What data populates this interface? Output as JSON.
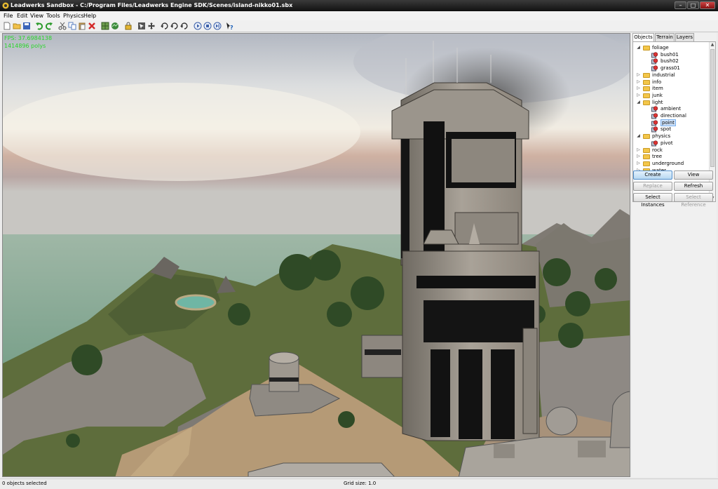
{
  "window": {
    "title": "Leadwerks Sandbox - C:/Program Files/Leadwerks Engine SDK/Scenes/island-nikko01.sbx",
    "controls": [
      "–",
      "□",
      "✕"
    ]
  },
  "menu": [
    "File",
    "Edit",
    "View",
    "Tools",
    "Physics",
    "Help"
  ],
  "toolbar": [
    "new-icon",
    "open-icon",
    "save-icon",
    "undo-icon",
    "redo-icon",
    "cut-icon",
    "copy-icon",
    "paste-icon",
    "delete-icon",
    "grid-icon",
    "terrain-icon",
    "lock-icon",
    "select-icon",
    "move-icon",
    "rotate-x-icon",
    "rotate-y-icon",
    "rotate-z-icon",
    "play-icon",
    "pause-icon",
    "step-icon",
    "help-icon"
  ],
  "viewport": {
    "fps": "FPS: 37.6984138",
    "polys": "1414896 polys"
  },
  "panel": {
    "tabs": [
      "Objects",
      "Terrain",
      "Layers"
    ],
    "active_tab": "Objects",
    "tree": [
      {
        "label": "foliage",
        "kind": "folder",
        "level": 0,
        "expanded": true
      },
      {
        "label": "bush01",
        "kind": "entity",
        "level": 1
      },
      {
        "label": "bush02",
        "kind": "entity",
        "level": 1
      },
      {
        "label": "grass01",
        "kind": "entity",
        "level": 1
      },
      {
        "label": "industrial",
        "kind": "folder",
        "level": 0,
        "expanded": false
      },
      {
        "label": "info",
        "kind": "folder",
        "level": 0,
        "expanded": false
      },
      {
        "label": "item",
        "kind": "folder",
        "level": 0,
        "expanded": false
      },
      {
        "label": "junk",
        "kind": "folder",
        "level": 0,
        "expanded": false
      },
      {
        "label": "light",
        "kind": "folder",
        "level": 0,
        "expanded": true
      },
      {
        "label": "ambient",
        "kind": "entity",
        "level": 1
      },
      {
        "label": "directional",
        "kind": "entity",
        "level": 1
      },
      {
        "label": "point",
        "kind": "entity",
        "level": 1,
        "selected": true
      },
      {
        "label": "spot",
        "kind": "entity",
        "level": 1
      },
      {
        "label": "physics",
        "kind": "folder",
        "level": 0,
        "expanded": true
      },
      {
        "label": "pivot",
        "kind": "entity",
        "level": 1
      },
      {
        "label": "rock",
        "kind": "folder",
        "level": 0,
        "expanded": false
      },
      {
        "label": "tree",
        "kind": "folder",
        "level": 0,
        "expanded": false
      },
      {
        "label": "underground",
        "kind": "folder",
        "level": 0,
        "expanded": false
      },
      {
        "label": "water",
        "kind": "folder",
        "level": 0,
        "expanded": false
      }
    ],
    "buttons": {
      "create": "Create",
      "view": "View",
      "replace": "Replace",
      "refresh": "Refresh",
      "select_instances": "Select Instances",
      "select_reference": "Select Reference"
    }
  },
  "status": {
    "selection": "0 objects selected",
    "grid": "Grid size: 1.0"
  },
  "colors": {
    "fps_text": "#2bd62b",
    "folder": "#f3c649",
    "selection": "#cfe3fb"
  }
}
